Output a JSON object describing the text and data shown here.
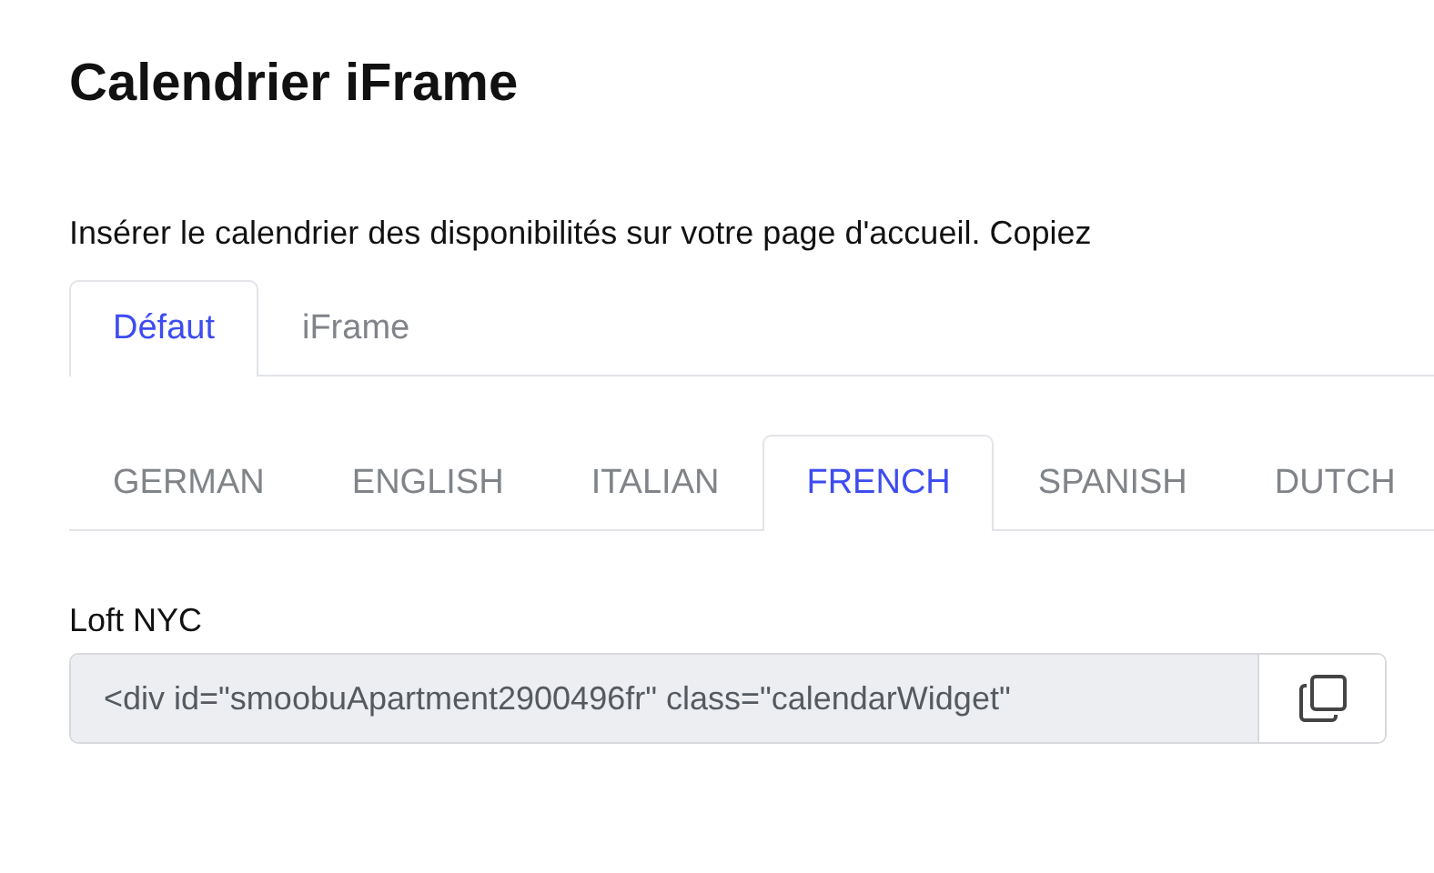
{
  "title": "Calendrier iFrame",
  "description": "Insérer le calendrier des disponibilités sur votre page d'accueil. Copiez",
  "mode_tabs": [
    {
      "label": "Défaut",
      "selected": true
    },
    {
      "label": "iFrame",
      "selected": false
    }
  ],
  "language_tabs": [
    {
      "label": "GERMAN",
      "selected": false
    },
    {
      "label": "ENGLISH",
      "selected": false
    },
    {
      "label": "ITALIAN",
      "selected": false
    },
    {
      "label": "FRENCH",
      "selected": true
    },
    {
      "label": "SPANISH",
      "selected": false
    },
    {
      "label": "DUTCH",
      "selected": false
    }
  ],
  "embed": {
    "label": "Loft NYC",
    "value": "<div id=\"smoobuApartment2900496fr\" class=\"calendarWidget\""
  }
}
